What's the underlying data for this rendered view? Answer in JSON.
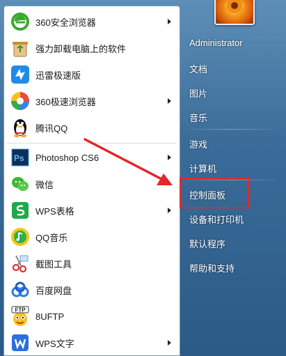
{
  "start_menu": {
    "programs": [
      {
        "label": "360安全浏览器",
        "icon": "360-secure-browser-icon",
        "submenu": true
      },
      {
        "label": "强力卸载电脑上的软件",
        "icon": "uninstaller-icon",
        "submenu": false
      },
      {
        "label": "迅雷极速版",
        "icon": "thunder-icon",
        "submenu": false
      },
      {
        "label": "360极速浏览器",
        "icon": "360-speed-browser-icon",
        "submenu": true
      },
      {
        "label": "腾讯QQ",
        "icon": "qq-penguin-icon",
        "submenu": false
      },
      {
        "label": "Photoshop CS6",
        "icon": "photoshop-icon",
        "submenu": true
      },
      {
        "label": "微信",
        "icon": "wechat-icon",
        "submenu": false
      },
      {
        "label": "WPS表格",
        "icon": "wps-spreadsheet-icon",
        "submenu": true
      },
      {
        "label": "QQ音乐",
        "icon": "qq-music-icon",
        "submenu": false
      },
      {
        "label": "截图工具",
        "icon": "snipping-tool-icon",
        "submenu": false
      },
      {
        "label": "百度网盘",
        "icon": "baidu-netdisk-icon",
        "submenu": false
      },
      {
        "label": "8UFTP",
        "icon": "8uftp-icon",
        "submenu": false
      },
      {
        "label": "WPS文字",
        "icon": "wps-writer-icon",
        "submenu": true
      }
    ],
    "right_panel": [
      {
        "label": "Administrator"
      },
      {
        "label": "文档"
      },
      {
        "label": "图片"
      },
      {
        "label": "音乐"
      },
      {
        "label": "游戏"
      },
      {
        "label": "计算机"
      },
      {
        "label": "控制面板"
      },
      {
        "label": "设备和打印机"
      },
      {
        "label": "默认程序"
      },
      {
        "label": "帮助和支持"
      }
    ],
    "highlight_color": "#e5262a",
    "ftp_badge": "FTP"
  }
}
